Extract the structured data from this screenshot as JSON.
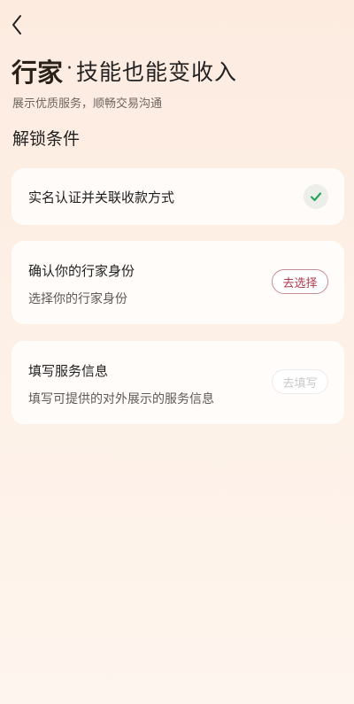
{
  "header": {
    "back_icon": "chevron-left-icon",
    "brand": "行家",
    "separator": "·",
    "slogan": "技能也能变收入",
    "subtitle": "展示优质服务，顺畅交易沟通"
  },
  "section": {
    "title": "解锁条件"
  },
  "conditions": [
    {
      "title": "实名认证并关联收款方式",
      "status_icon": "check-icon",
      "completed": true
    },
    {
      "title": "确认你的行家身份",
      "description": "选择你的行家身份",
      "action_label": "去选择",
      "enabled": true
    },
    {
      "title": "填写服务信息",
      "description": "填写可提供的对外展示的服务信息",
      "action_label": "去填写",
      "enabled": false
    }
  ],
  "colors": {
    "accent": "#b0384c",
    "check": "#2aa55a",
    "background": "#fdebe0"
  }
}
